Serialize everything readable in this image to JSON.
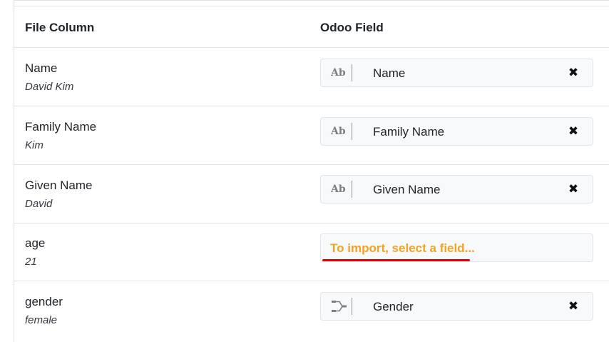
{
  "header": {
    "file_column": "File Column",
    "odoo_field": "Odoo Field"
  },
  "rows": [
    {
      "name": "Name",
      "sample": "David Kim",
      "field": "Name",
      "field_type": "Ab",
      "type_icon": "text-icon",
      "mapped": true
    },
    {
      "name": "Family Name",
      "sample": "Kim",
      "field": "Family Name",
      "field_type": "Ab",
      "type_icon": "text-icon",
      "mapped": true
    },
    {
      "name": "Given Name",
      "sample": "David",
      "field": "Given Name",
      "field_type": "Ab",
      "type_icon": "text-icon",
      "mapped": true
    },
    {
      "name": "age",
      "sample": "21",
      "placeholder": "To import, select a field...",
      "mapped": false
    },
    {
      "name": "gender",
      "sample": "female",
      "field": "Gender",
      "type_icon": "selection-icon",
      "mapped": true
    }
  ],
  "clear_glyph": "✖",
  "colors": {
    "placeholder": "#f0a422",
    "annotation_underline": "#e00000"
  }
}
